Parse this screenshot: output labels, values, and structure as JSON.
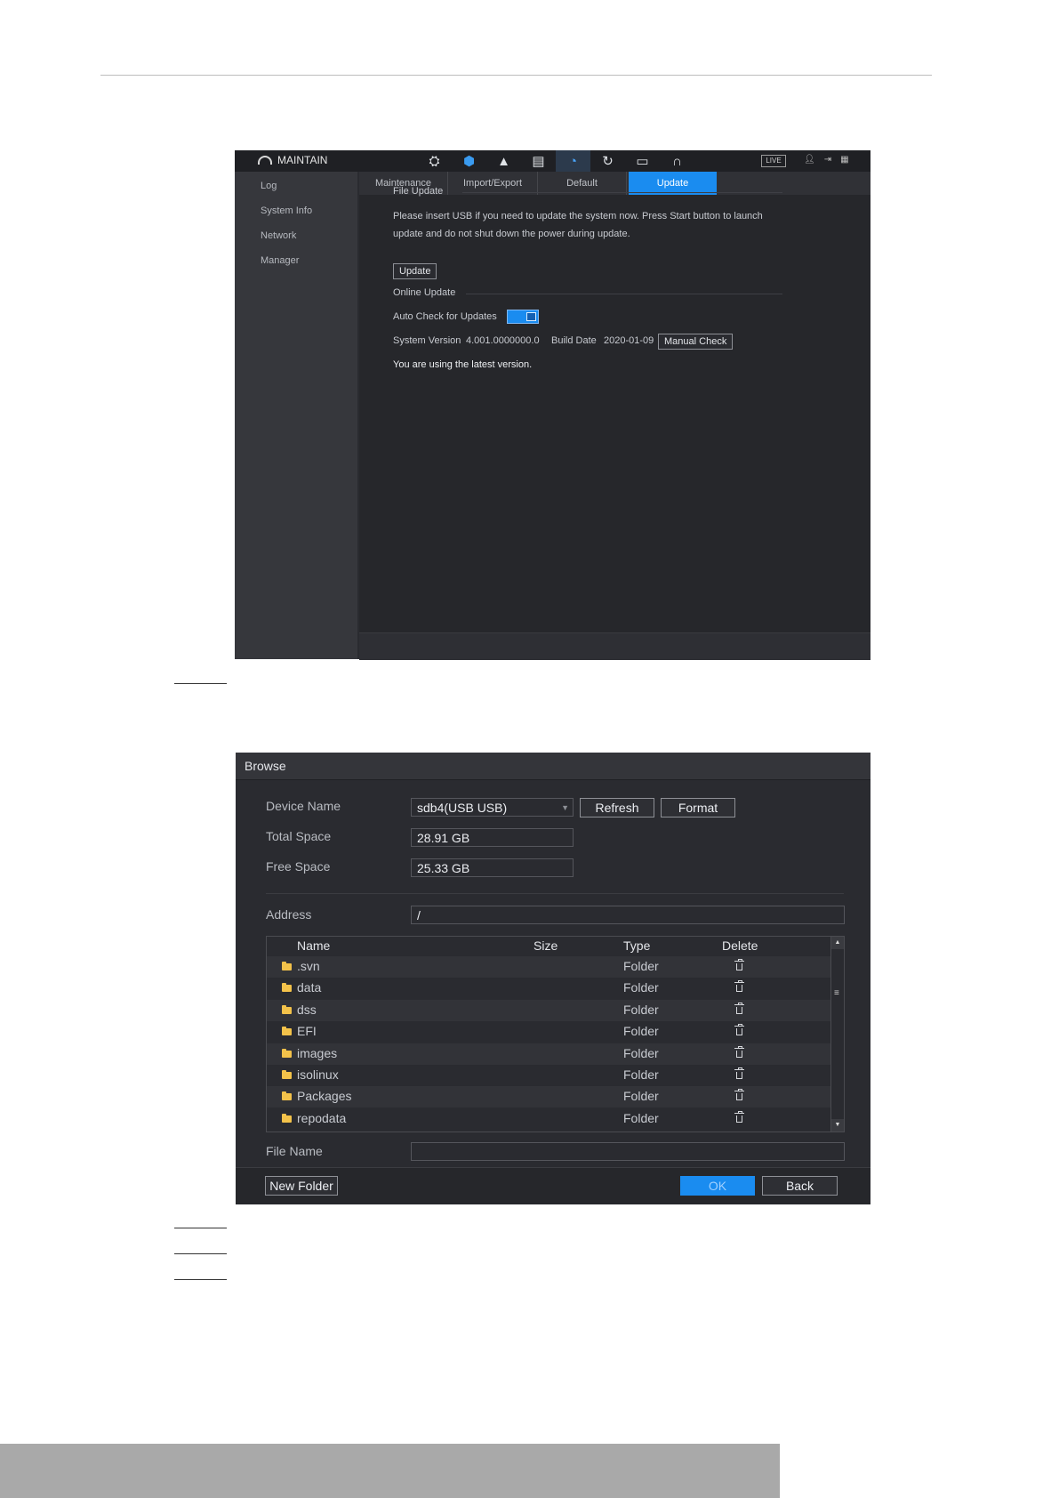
{
  "maintain": {
    "title": "MAINTAIN",
    "top_icons": [
      {
        "name": "camera-reel-icon",
        "glyph": "⛭"
      },
      {
        "name": "shield-icon",
        "glyph": "⬢"
      },
      {
        "name": "alarm-bell-icon",
        "glyph": "▲"
      },
      {
        "name": "storage-icon",
        "glyph": "▤"
      },
      {
        "name": "maintain-gauge-icon",
        "glyph": "◔"
      },
      {
        "name": "refresh-icon",
        "glyph": "↻"
      },
      {
        "name": "display-icon",
        "glyph": "▭"
      },
      {
        "name": "headset-icon",
        "glyph": "∩"
      }
    ],
    "live_label": "LIVE",
    "sidebar": [
      "Log",
      "System Info",
      "Network",
      "Manager"
    ],
    "tabs": [
      "Maintenance",
      "Import/Export",
      "Default",
      "Update"
    ],
    "file_update": {
      "heading": "File Update",
      "text": "Please insert USB if you need to update the system now. Press Start button to launch update and do not shut down the power during update.",
      "button": "Update"
    },
    "online_update": {
      "heading": "Online Update",
      "auto_check_label": "Auto Check for Updates",
      "auto_check_on": true,
      "system_version_label": "System Version",
      "system_version": "4.001.0000000.0",
      "build_date_label": "Build Date",
      "build_date": "2020-01-09",
      "manual_check": "Manual Check",
      "status": "You are using the latest version."
    }
  },
  "browse": {
    "title": "Browse",
    "device_name_label": "Device Name",
    "device_name": "sdb4(USB USB)",
    "refresh": "Refresh",
    "format": "Format",
    "total_space_label": "Total Space",
    "total_space": "28.91 GB",
    "free_space_label": "Free Space",
    "free_space": "25.33 GB",
    "address_label": "Address",
    "address": "/",
    "columns": [
      "Name",
      "Size",
      "Type",
      "Delete"
    ],
    "rows": [
      {
        "name": ".svn",
        "size": "",
        "type": "Folder"
      },
      {
        "name": "data",
        "size": "",
        "type": "Folder"
      },
      {
        "name": "dss",
        "size": "",
        "type": "Folder"
      },
      {
        "name": "EFI",
        "size": "",
        "type": "Folder"
      },
      {
        "name": "images",
        "size": "",
        "type": "Folder"
      },
      {
        "name": "isolinux",
        "size": "",
        "type": "Folder"
      },
      {
        "name": "Packages",
        "size": "",
        "type": "Folder"
      },
      {
        "name": "repodata",
        "size": "",
        "type": "Folder"
      }
    ],
    "file_name_label": "File Name",
    "file_name": "",
    "new_folder": "New Folder",
    "ok": "OK",
    "back": "Back"
  },
  "colors": {
    "accent": "#1a8cf0",
    "panel_bg": "#2a2b30",
    "folder": "#f3c24a"
  }
}
